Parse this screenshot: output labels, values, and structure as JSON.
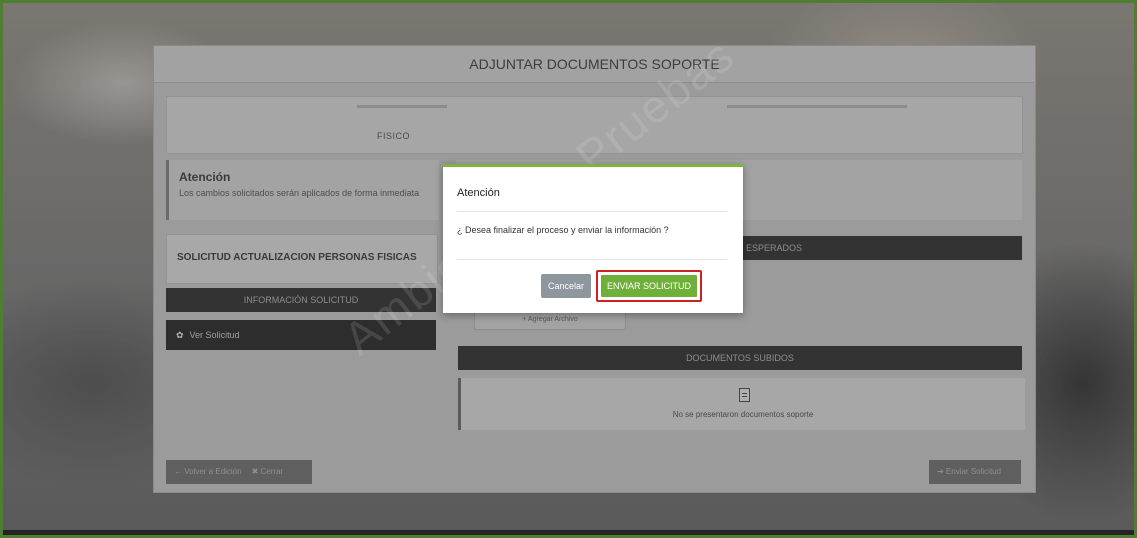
{
  "panel": {
    "title": "ADJUNTAR DOCUMENTOS SOPORTE",
    "person_type_value": "FISICO",
    "alert": {
      "title": "Atención",
      "description": "Los cambios solicitados serán aplicados de forma inmediata"
    },
    "request_card_title": "SOLICITUD ACTUALIZACION PERSONAS FISICAS",
    "info_bar_label": "INFORMACIÓN SOLICITUD",
    "view_request_label": "Ver Solicitud",
    "expected_docs_label": "ESPERADOS",
    "add_file_label": "+ Agregar Archivo",
    "uploaded_docs_label": "DOCUMENTOS SUBIDOS",
    "no_docs_message": "No se presentaron documentos soporte",
    "back_button": "← Volver a Edición",
    "close_button": "✖ Cerrar",
    "send_button_bottom": "➔ Enviar Solicitud",
    "watermark": "Ambiente de Pruebas"
  },
  "modal": {
    "title": "Atención",
    "message": "¿ Desea finalizar el proceso y enviar la información ?",
    "cancel_label": "Cancelar",
    "confirm_label": "ENVIAR SOLICITUD"
  },
  "colors": {
    "frame_border": "#4f7d34",
    "modal_accent": "#7fb53c",
    "confirm_button": "#6fb03a",
    "highlight_outline": "#cc2222",
    "cancel_button": "#8e969e"
  },
  "icons": {
    "view_request": "gear-icon",
    "document": "document-icon"
  }
}
